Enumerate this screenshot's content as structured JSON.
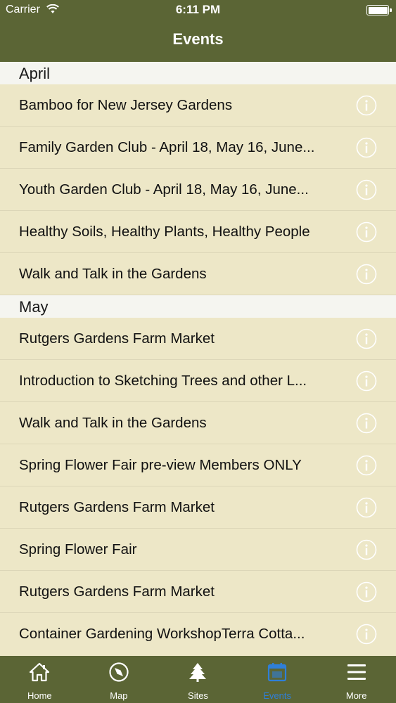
{
  "status": {
    "carrier": "Carrier",
    "time": "6:11 PM"
  },
  "nav": {
    "title": "Events"
  },
  "sections": [
    {
      "title": "April",
      "items": [
        "Bamboo for New Jersey Gardens",
        "Family Garden Club - April 18, May 16, June...",
        "Youth Garden Club - April 18, May 16, June...",
        "Healthy Soils, Healthy Plants, Healthy People",
        "Walk and Talk in the Gardens"
      ]
    },
    {
      "title": "May",
      "items": [
        "Rutgers Gardens Farm Market",
        "Introduction to Sketching Trees and other L...",
        "Walk and Talk in the Gardens",
        "Spring Flower Fair pre-view Members ONLY",
        "Rutgers Gardens Farm Market",
        "Spring Flower Fair",
        "Rutgers Gardens Farm Market",
        "Container Gardening WorkshopTerra Cotta..."
      ]
    }
  ],
  "tabs": [
    {
      "label": "Home",
      "icon": "home-icon"
    },
    {
      "label": "Map",
      "icon": "compass-icon"
    },
    {
      "label": "Sites",
      "icon": "tree-icon"
    },
    {
      "label": "Events",
      "icon": "calendar-icon",
      "active": true
    },
    {
      "label": "More",
      "icon": "menu-icon"
    }
  ],
  "colors": {
    "bar": "#5b6535",
    "list_bg": "#ede7c7",
    "active_tab": "#2f7fd8"
  }
}
